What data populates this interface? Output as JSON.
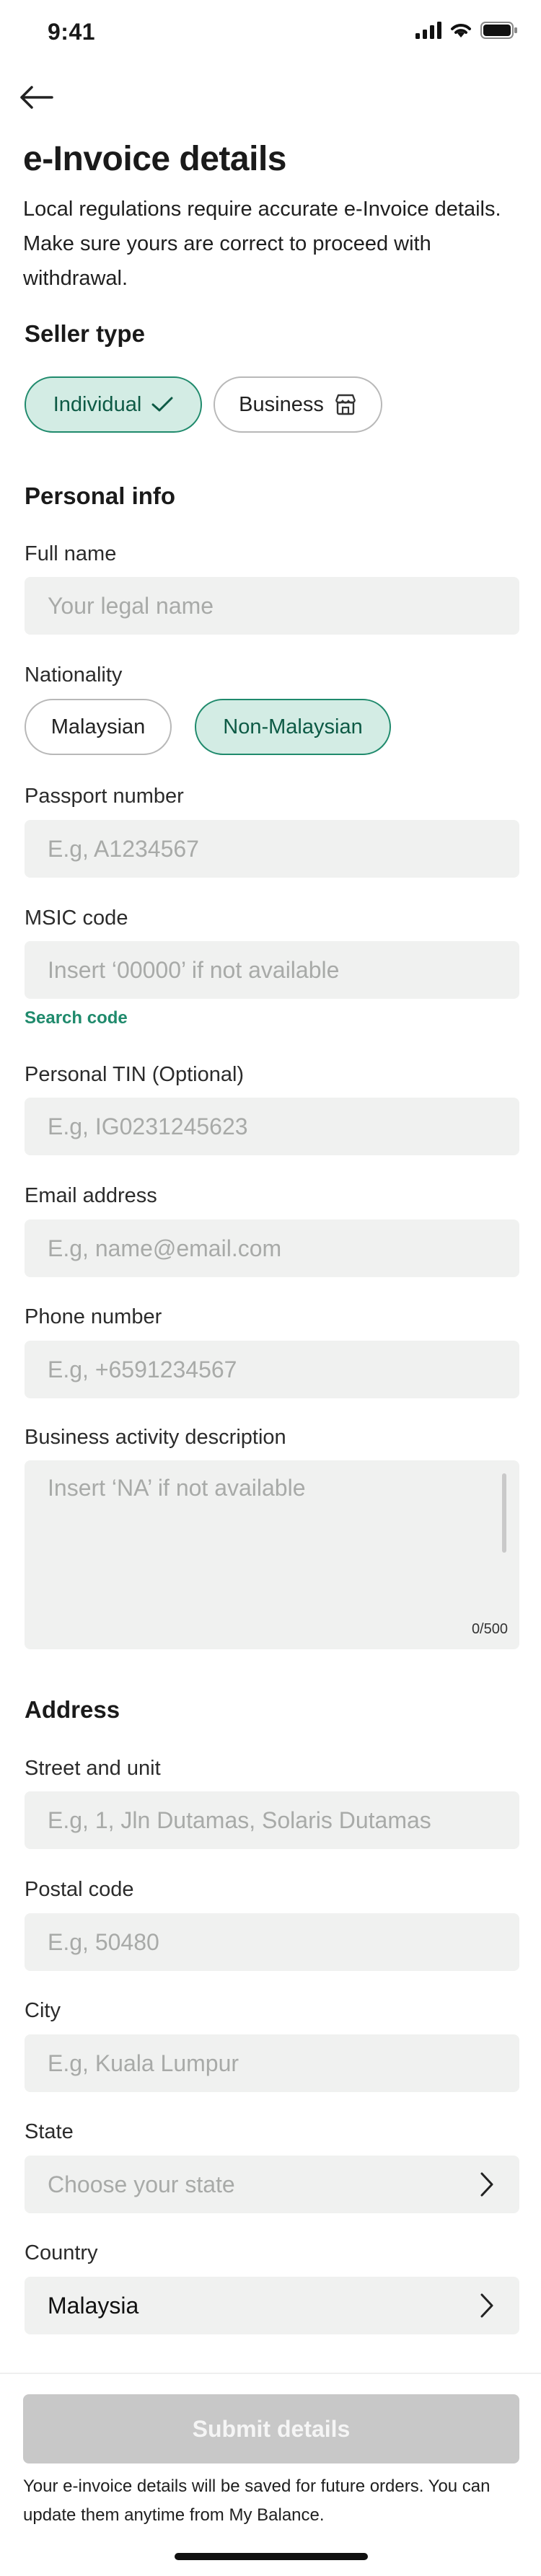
{
  "status_bar": {
    "time": "9:41"
  },
  "header": {
    "title": "e-Invoice details",
    "description": "Local regulations require accurate e-Invoice details. Make sure yours are correct to proceed with withdrawal."
  },
  "seller_type": {
    "title": "Seller type",
    "options": [
      {
        "label": "Individual",
        "selected": true
      },
      {
        "label": "Business",
        "selected": false
      }
    ]
  },
  "personal_info": {
    "title": "Personal info",
    "full_name": {
      "label": "Full name",
      "placeholder": "Your legal name"
    },
    "nationality": {
      "label": "Nationality",
      "options": [
        {
          "label": "Malaysian",
          "selected": false
        },
        {
          "label": "Non-Malaysian",
          "selected": true
        }
      ]
    },
    "passport": {
      "label": "Passport number",
      "placeholder": "E.g, A1234567"
    },
    "msic": {
      "label": "MSIC code",
      "placeholder": "Insert ‘00000’ if not available",
      "search_link": "Search code"
    },
    "tin": {
      "label": "Personal TIN (Optional)",
      "placeholder": "E.g, IG0231245623"
    },
    "email": {
      "label": "Email address",
      "placeholder": "E.g, name@email.com"
    },
    "phone": {
      "label": "Phone number",
      "placeholder": "E.g, +6591234567"
    },
    "business_activity": {
      "label": "Business activity description",
      "placeholder": "Insert ‘NA’ if not available",
      "counter": "0/500"
    }
  },
  "address": {
    "title": "Address",
    "street": {
      "label": "Street and unit",
      "placeholder": "E.g, 1, Jln Dutamas, Solaris Dutamas"
    },
    "postal": {
      "label": "Postal code",
      "placeholder": "E.g, 50480"
    },
    "city": {
      "label": "City",
      "placeholder": "E.g, Kuala Lumpur"
    },
    "state": {
      "label": "State",
      "placeholder": "Choose your state"
    },
    "country": {
      "label": "Country",
      "value": "Malaysia"
    }
  },
  "footer": {
    "submit_label": "Submit details",
    "note": "Your e-invoice details will be saved for future orders. You can update them anytime from My Balance."
  },
  "colors": {
    "accent": "#1f8a6c",
    "chip_selected_bg": "#d3ece4",
    "input_bg": "#f0f1f0",
    "button_disabled": "#c8c8c8"
  }
}
